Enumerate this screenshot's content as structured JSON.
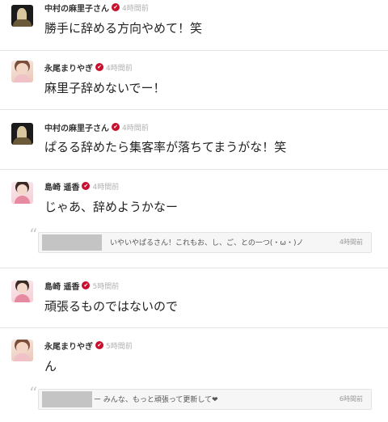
{
  "posts": [
    {
      "author": "中村の麻里子さん",
      "verified_mark": "✔",
      "time": "4時間前",
      "text": "勝手に辞める方向やめて！笑",
      "avatar_icon": "member-avatar-icon"
    },
    {
      "author": "永尾まりやぎ",
      "verified_mark": "✔",
      "time": "4時間前",
      "text": "麻里子辞めないでー！",
      "avatar_icon": "member-avatar-icon"
    },
    {
      "author": "中村の麻里子さん",
      "verified_mark": "✔",
      "time": "4時間前",
      "text": "ぱるる辞めたら集客率が落ちてまうがな！笑",
      "avatar_icon": "member-avatar-icon"
    },
    {
      "author": "島崎 遥香",
      "verified_mark": "✔",
      "time": "4時間前",
      "text": "じゃあ、辞めようかなー",
      "avatar_icon": "member-avatar-icon",
      "reply": {
        "text": "いやいやぱるさん！これもお、し、ご、との一つ(・ω・)ノ",
        "time": "4時間前"
      }
    },
    {
      "author": "島崎 遥香",
      "verified_mark": "✔",
      "time": "5時間前",
      "text": "頑張るものではないので",
      "avatar_icon": "member-avatar-icon"
    },
    {
      "author": "永尾まりやぎ",
      "verified_mark": "✔",
      "time": "5時間前",
      "text": "ん",
      "avatar_icon": "member-avatar-icon",
      "reply": {
        "text": "ー みんな、もっと頑張って更新して❤",
        "time": "6時間前"
      }
    }
  ],
  "quote_glyph": "“",
  "colors": {
    "verified_badge": "#c8102e",
    "timestamp": "#b0b0b0",
    "divider": "#e4e4e4",
    "reply_background": "#f6f6f6"
  }
}
